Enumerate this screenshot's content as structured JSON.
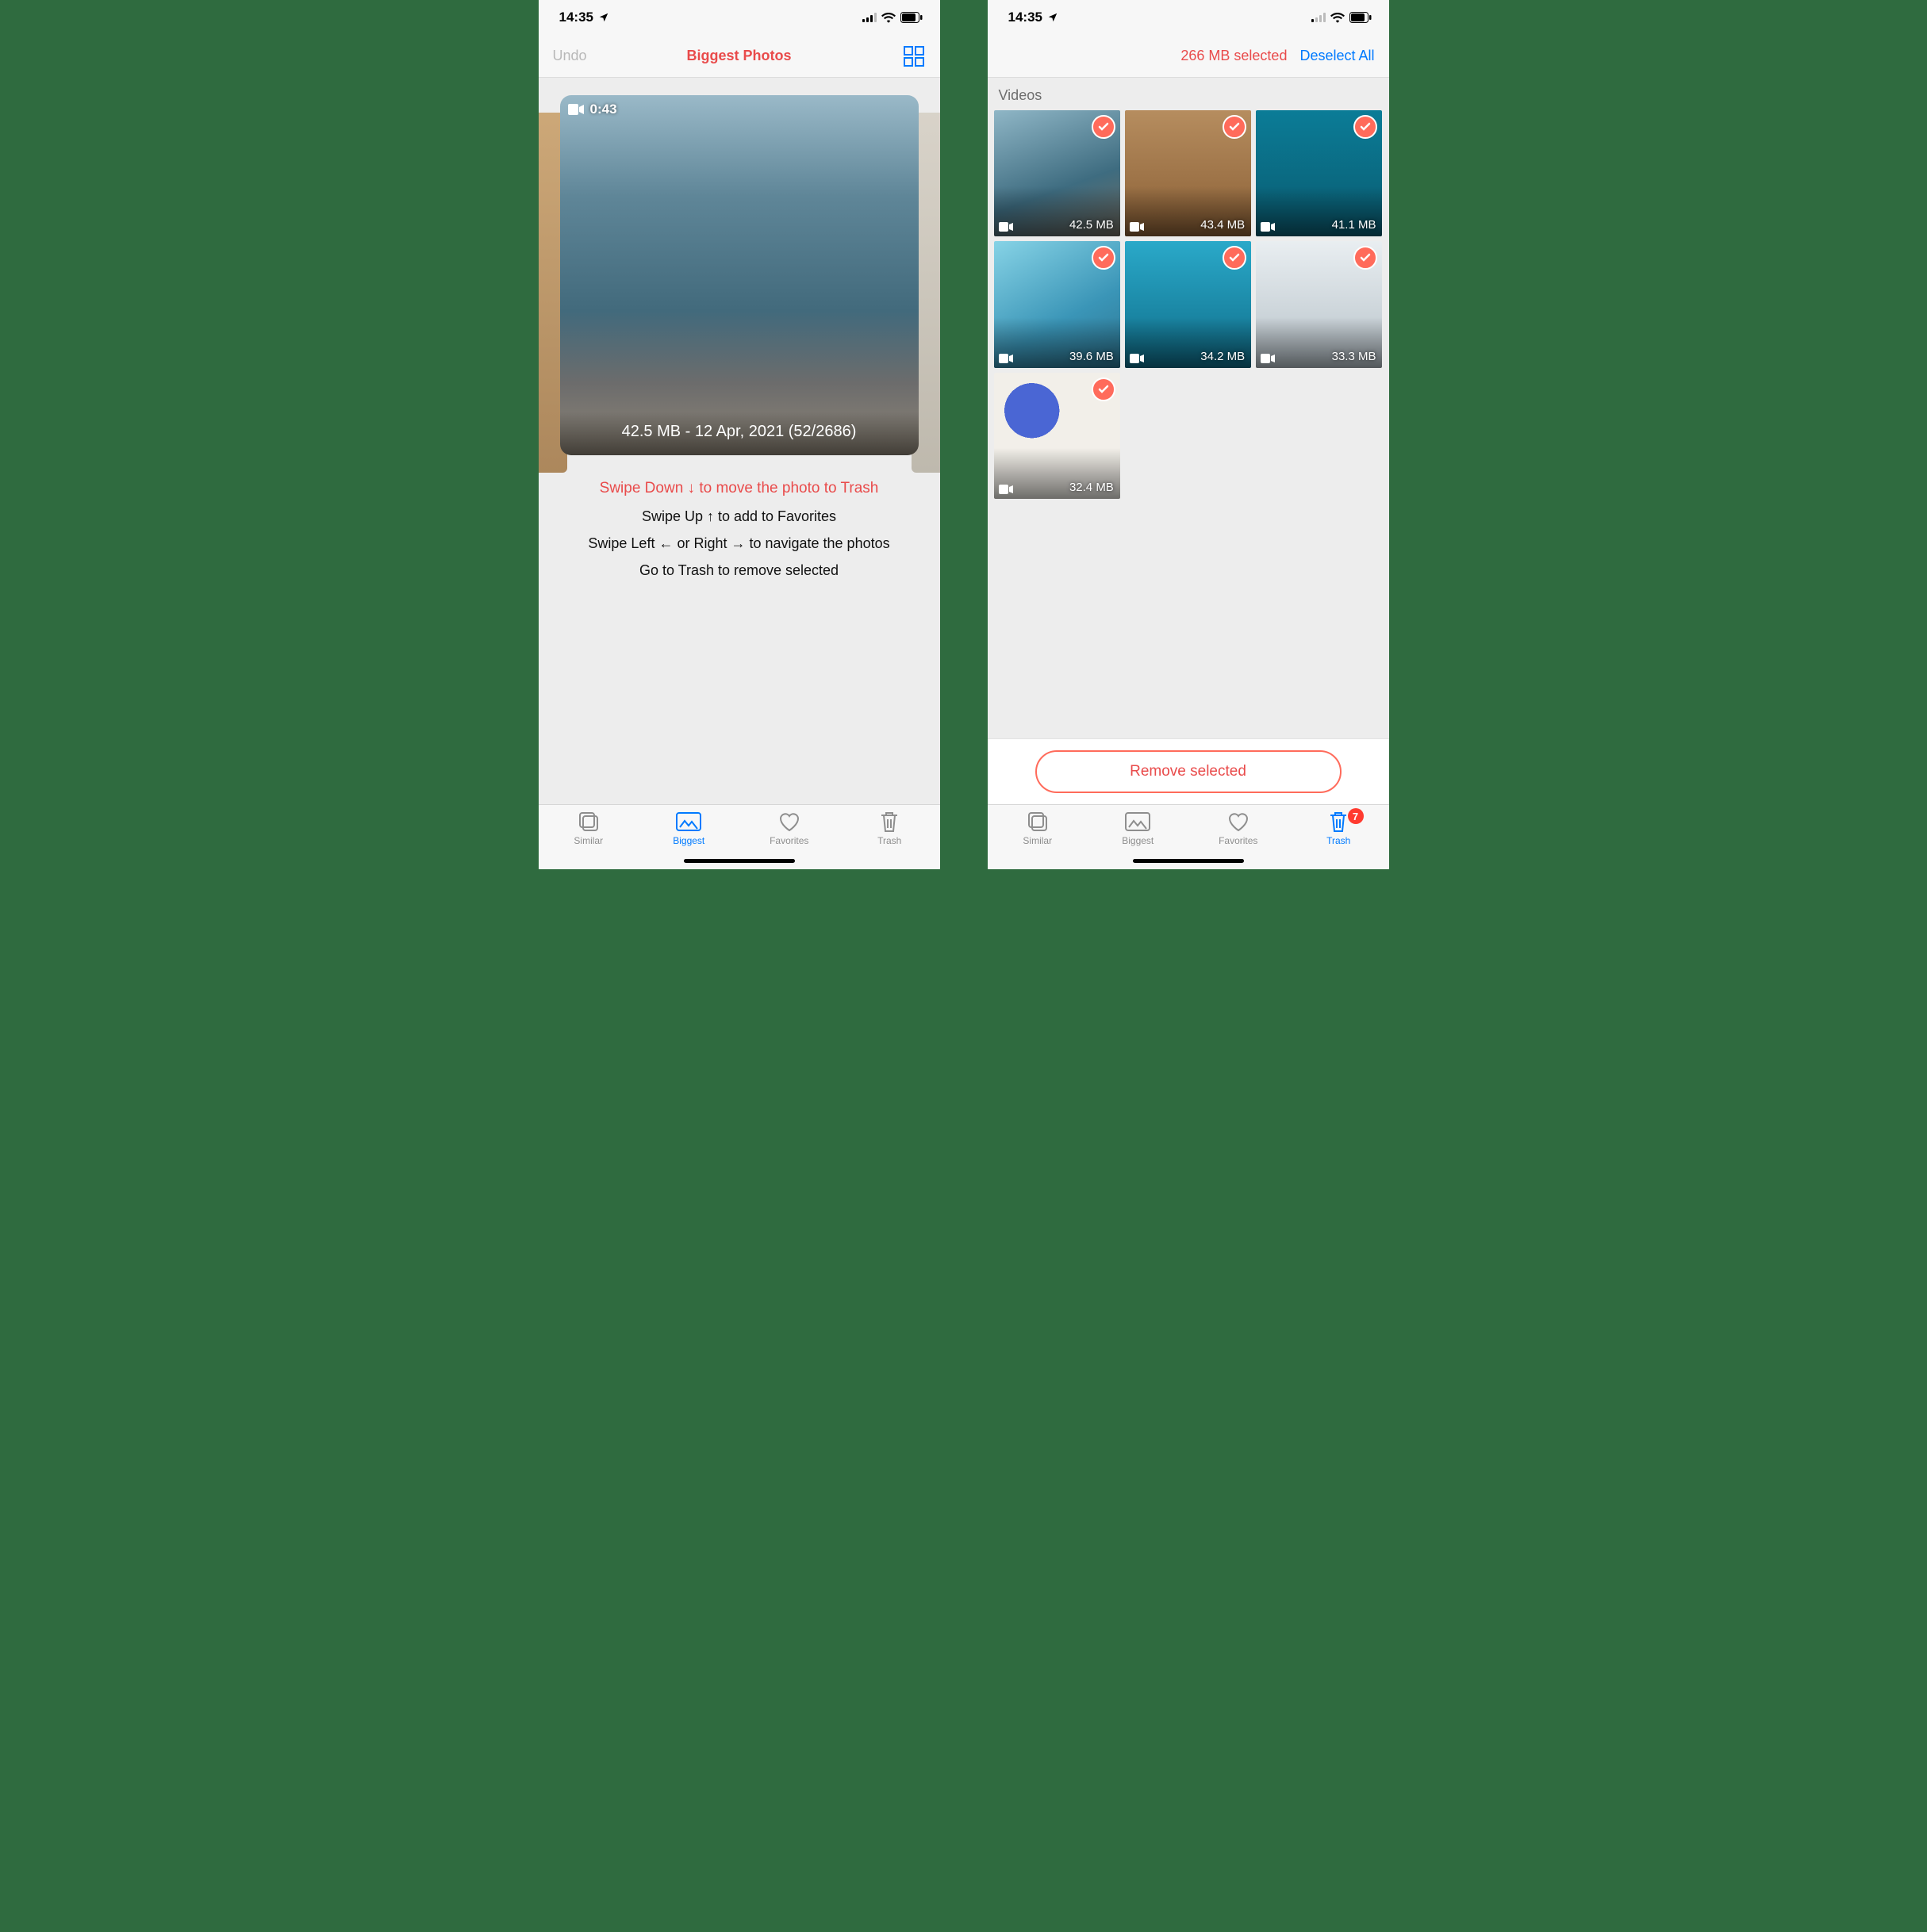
{
  "statusbar": {
    "time": "14:35"
  },
  "left": {
    "nav": {
      "undo": "Undo",
      "title": "Biggest Photos"
    },
    "card": {
      "duration": "0:43",
      "meta": "42.5 MB - 12 Apr, 2021 (52/2686)"
    },
    "hints": {
      "down": "Swipe Down ↓ to move the photo to Trash",
      "up": "Swipe Up ↑ to add to Favorites",
      "lr": "Swipe Left ← or Right → to navigate the photos",
      "trash": "Go to Trash to remove selected"
    }
  },
  "right": {
    "nav": {
      "selected": "266 MB selected",
      "deselect": "Deselect All"
    },
    "section": "Videos",
    "videos": [
      {
        "size": "42.5 MB"
      },
      {
        "size": "43.4 MB"
      },
      {
        "size": "41.1 MB"
      },
      {
        "size": "39.6 MB"
      },
      {
        "size": "34.2 MB"
      },
      {
        "size": "33.3 MB"
      },
      {
        "size": "32.4 MB"
      }
    ],
    "remove": "Remove selected",
    "badge": "7"
  },
  "tabs": {
    "similar": "Similar",
    "biggest": "Biggest",
    "favorites": "Favorites",
    "trash": "Trash"
  }
}
